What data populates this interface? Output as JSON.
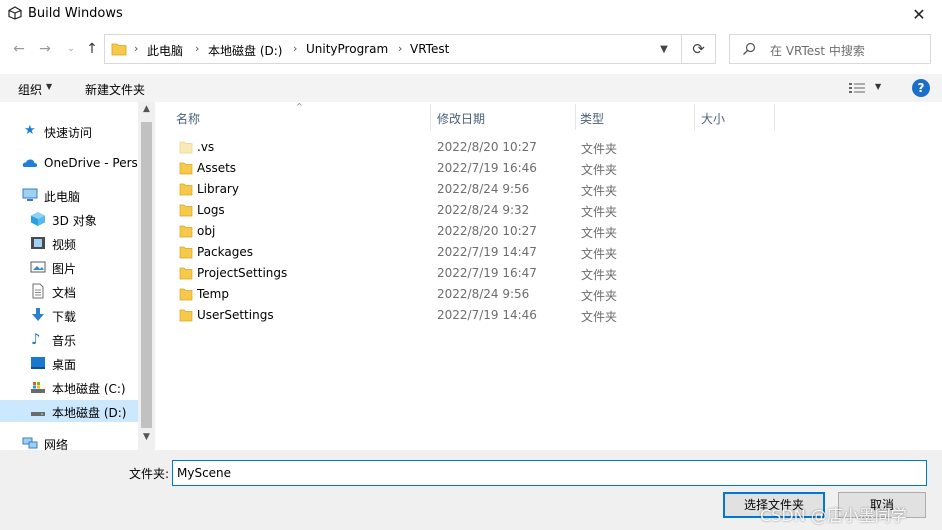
{
  "window": {
    "title": "Build Windows",
    "close_label": "✕"
  },
  "nav": {
    "breadcrumbs": [
      "此电脑",
      "本地磁盘 (D:)",
      "UnityProgram",
      "VRTest"
    ],
    "separator": "›",
    "search_placeholder": "在 VRTest 中搜索"
  },
  "toolbar": {
    "organize_label": "组织",
    "new_folder_label": "新建文件夹",
    "help_label": "?"
  },
  "sidebar": {
    "items": [
      {
        "label": "快速访问",
        "icon": "star-icon"
      },
      {
        "label": "OneDrive - Perso",
        "icon": "cloud-icon"
      },
      {
        "label": "此电脑",
        "icon": "computer-icon"
      },
      {
        "label": "3D 对象",
        "icon": "cube-icon"
      },
      {
        "label": "视频",
        "icon": "video-icon"
      },
      {
        "label": "图片",
        "icon": "picture-icon"
      },
      {
        "label": "文档",
        "icon": "document-icon"
      },
      {
        "label": "下载",
        "icon": "download-icon"
      },
      {
        "label": "音乐",
        "icon": "music-icon"
      },
      {
        "label": "桌面",
        "icon": "desktop-icon"
      },
      {
        "label": "本地磁盘 (C:)",
        "icon": "drive-icon"
      },
      {
        "label": "本地磁盘 (D:)",
        "icon": "drive-icon",
        "selected": true
      },
      {
        "label": "网络",
        "icon": "network-icon"
      }
    ]
  },
  "filelist": {
    "columns": [
      "名称",
      "修改日期",
      "类型",
      "大小"
    ],
    "rows": [
      {
        "name": ".vs",
        "date": "2022/8/20 10:27",
        "type": "文件夹",
        "hidden": true
      },
      {
        "name": "Assets",
        "date": "2022/7/19 16:46",
        "type": "文件夹"
      },
      {
        "name": "Library",
        "date": "2022/8/24 9:56",
        "type": "文件夹"
      },
      {
        "name": "Logs",
        "date": "2022/8/24 9:32",
        "type": "文件夹"
      },
      {
        "name": "obj",
        "date": "2022/8/20 10:27",
        "type": "文件夹"
      },
      {
        "name": "Packages",
        "date": "2022/7/19 14:47",
        "type": "文件夹"
      },
      {
        "name": "ProjectSettings",
        "date": "2022/7/19 16:47",
        "type": "文件夹"
      },
      {
        "name": "Temp",
        "date": "2022/8/24 9:56",
        "type": "文件夹"
      },
      {
        "name": "UserSettings",
        "date": "2022/7/19 14:46",
        "type": "文件夹"
      }
    ]
  },
  "footer": {
    "folder_label": "文件夹:",
    "folder_value": "MyScene",
    "select_label": "选择文件夹",
    "cancel_label": "取消"
  },
  "watermark": "CSDN @唐小墨同学",
  "colors": {
    "accent": "#0078d7",
    "folder": "#f6c94a",
    "selected_bg": "#cce8ff"
  }
}
